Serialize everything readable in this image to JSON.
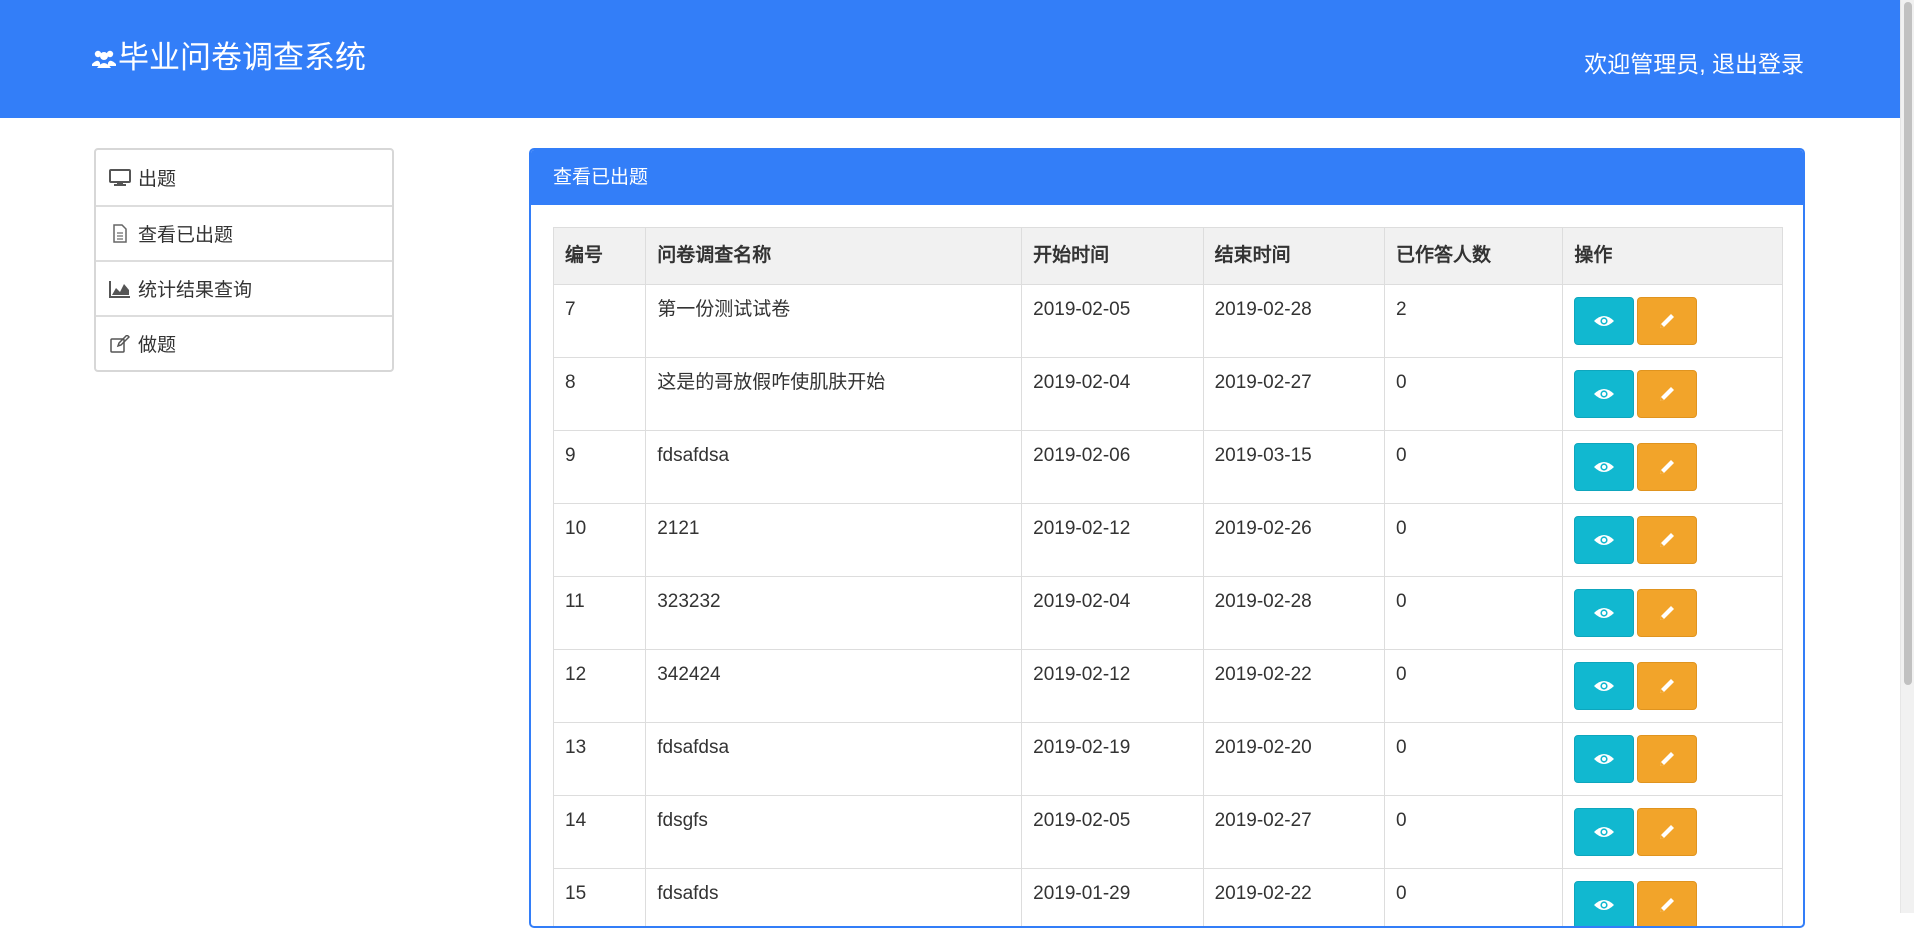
{
  "header": {
    "brand": "毕业问卷调查系统",
    "welcome": "欢迎管理员,",
    "logout": "退出登录"
  },
  "sidebar": {
    "items": [
      {
        "label": "出题",
        "icon": "monitor-icon"
      },
      {
        "label": "查看已出题",
        "icon": "file-icon"
      },
      {
        "label": "统计结果查询",
        "icon": "area-chart-icon"
      },
      {
        "label": "做题",
        "icon": "edit-icon"
      }
    ]
  },
  "panel": {
    "title": "查看已出题"
  },
  "table": {
    "columns": [
      "编号",
      "问卷调查名称",
      "开始时间",
      "结束时间",
      "已作答人数",
      "操作"
    ],
    "rows": [
      {
        "id": "7",
        "name": "第一份测试试卷",
        "start": "2019-02-05",
        "end": "2019-02-28",
        "count": "2"
      },
      {
        "id": "8",
        "name": "这是的哥放假咋使肌肤开始",
        "start": "2019-02-04",
        "end": "2019-02-27",
        "count": "0"
      },
      {
        "id": "9",
        "name": "fdsafdsa",
        "start": "2019-02-06",
        "end": "2019-03-15",
        "count": "0"
      },
      {
        "id": "10",
        "name": "2121",
        "start": "2019-02-12",
        "end": "2019-02-26",
        "count": "0"
      },
      {
        "id": "11",
        "name": "323232",
        "start": "2019-02-04",
        "end": "2019-02-28",
        "count": "0"
      },
      {
        "id": "12",
        "name": "342424",
        "start": "2019-02-12",
        "end": "2019-02-22",
        "count": "0"
      },
      {
        "id": "13",
        "name": "fdsafdsa",
        "start": "2019-02-19",
        "end": "2019-02-20",
        "count": "0"
      },
      {
        "id": "14",
        "name": "fdsgfs",
        "start": "2019-02-05",
        "end": "2019-02-27",
        "count": "0"
      },
      {
        "id": "15",
        "name": "fdsafds",
        "start": "2019-01-29",
        "end": "2019-02-22",
        "count": "0"
      }
    ]
  },
  "colors": {
    "primary": "#337ef8",
    "view_button": "#11b8d0",
    "edit_button": "#f2a42a"
  }
}
